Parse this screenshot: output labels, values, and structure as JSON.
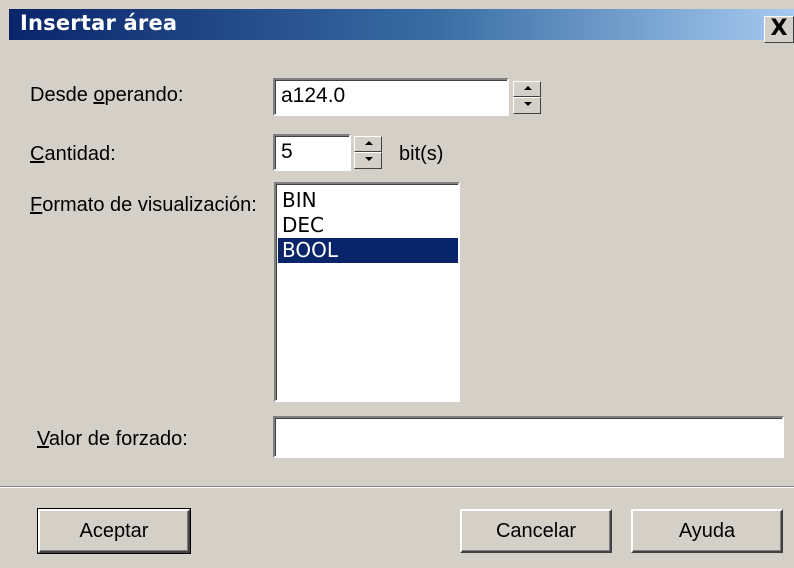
{
  "window": {
    "title": "Insertar área",
    "close_glyph": "X"
  },
  "form": {
    "desde": {
      "label_pre": "Desde ",
      "label_ul": "o",
      "label_post": "perando:",
      "value": "a124.0"
    },
    "cantidad": {
      "label_pre": "",
      "label_ul": "C",
      "label_post": "antidad:",
      "value": "5",
      "unit": "bit(s)"
    },
    "formato": {
      "label_pre": "",
      "label_ul": "F",
      "label_post": "ormato de visualización:",
      "options": [
        "BIN",
        "DEC",
        "BOOL"
      ],
      "selected": "BOOL"
    },
    "valor": {
      "label_pre": "",
      "label_ul": "V",
      "label_post": "alor de forzado:",
      "value": ""
    }
  },
  "buttons": {
    "accept": "Aceptar",
    "cancel": "Cancelar",
    "help": "Ayuda"
  }
}
